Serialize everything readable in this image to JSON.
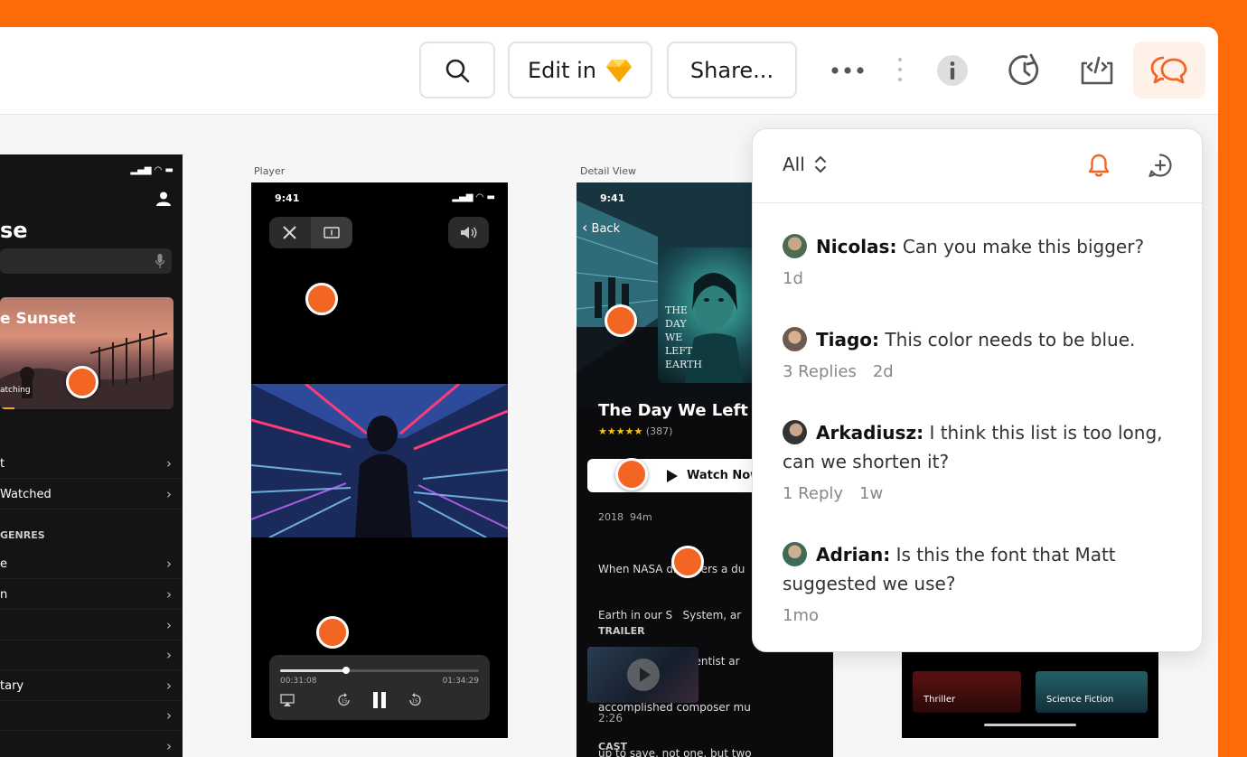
{
  "toolbar": {
    "edit_label": "Edit in",
    "share_label": "Share..."
  },
  "artboards": {
    "player_label": "Player",
    "detail_label": "Detail View"
  },
  "browse_screen": {
    "title_fragment": "se",
    "hero_title": "e Sunset",
    "hero_sub": "atching",
    "rows": [
      "t",
      "Watched"
    ],
    "genres_header": "GENRES",
    "genre_rows": [
      "e",
      "n",
      "",
      "",
      "tary",
      "",
      ""
    ]
  },
  "player_screen": {
    "time": "9:41",
    "elapsed": "00:31:08",
    "total": "01:34:29",
    "progress": 0.33
  },
  "detail_screen": {
    "time": "9:41",
    "back": "Back",
    "poster_text": "THE DAY WE LEFT EARTH",
    "title": "The Day We Left Ea",
    "stars": "★★★★★",
    "rating_count": "(387)",
    "watch_now": "Watch Now",
    "year": "2018",
    "duration": "94m",
    "synopsis": [
      "When NASA discovers a du",
      "Earth in our S   System, ar",
      "ambitious you   cientist ar",
      "accomplished composer mu",
      "up to save, not one, but two"
    ],
    "trailer_header": "TRAILER",
    "trailer_length": "2:26",
    "cast_header": "CAST"
  },
  "genre_screen": {
    "tile1": "Thriller",
    "tile2": "Science Fiction"
  },
  "comments_panel": {
    "filter": "All",
    "comments": [
      {
        "author": "Nicolas:",
        "text": "Can you make this bigger?",
        "replies": "",
        "age": "1d"
      },
      {
        "author": "Tiago:",
        "text": "This color needs to be blue.",
        "replies": "3 Replies",
        "age": "2d"
      },
      {
        "author": "Arkadiusz:",
        "text": "I think this list is too long, can we shorten it?",
        "replies": "1 Reply",
        "age": "1w"
      },
      {
        "author": "Adrian:",
        "text": "Is this the font that Matt suggested we use?",
        "replies": "",
        "age": "1mo"
      }
    ]
  },
  "colors": {
    "brand_orange": "#fd6a08",
    "pin": "#f26522",
    "comments_active_bg": "#fff0e8"
  }
}
